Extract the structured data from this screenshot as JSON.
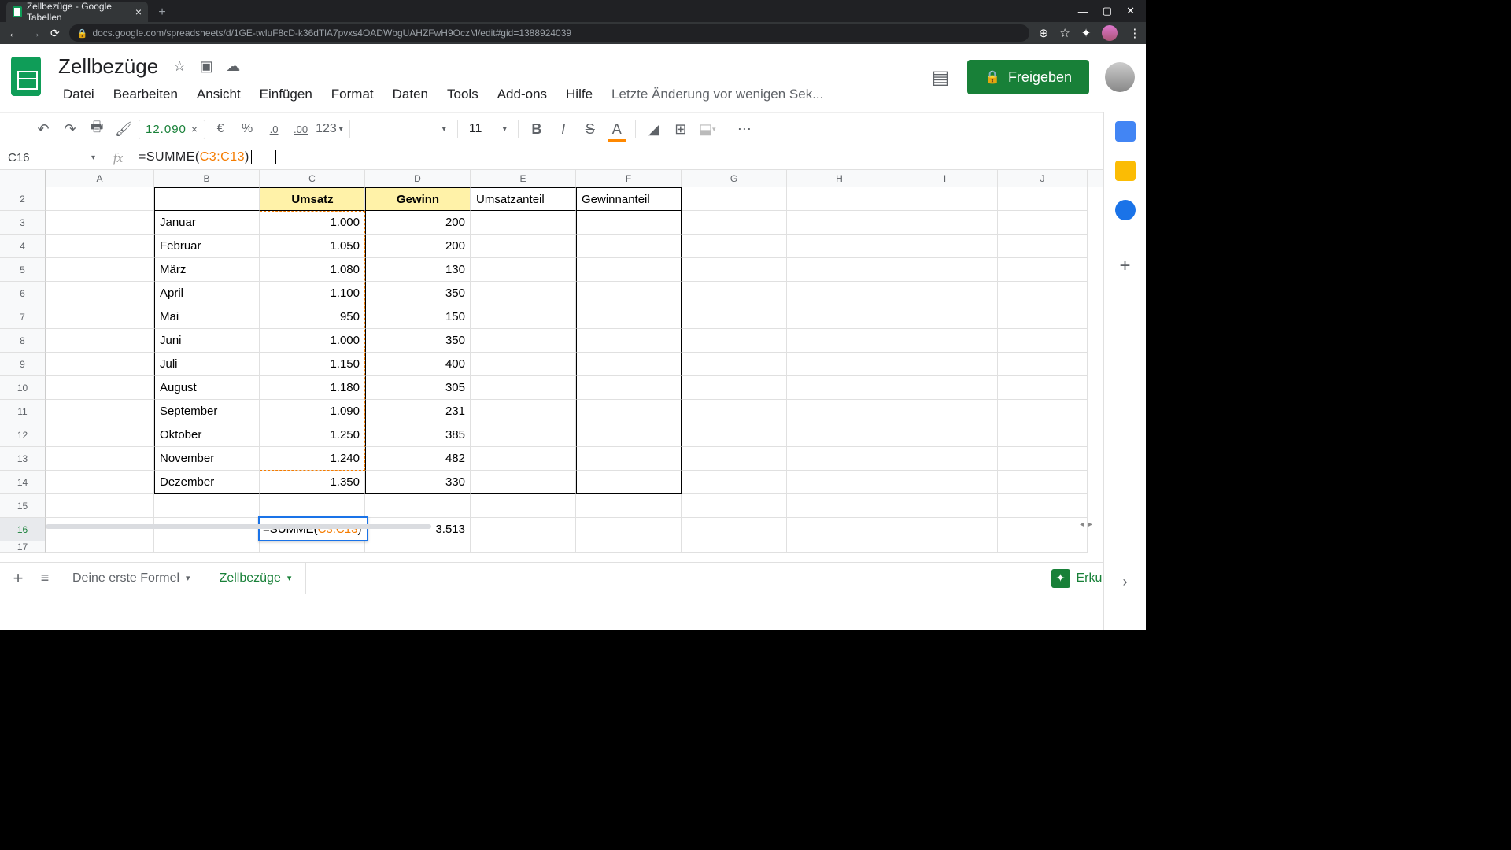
{
  "browser": {
    "tab_title": "Zellbezüge - Google Tabellen",
    "url": "docs.google.com/spreadsheets/d/1GE-twluF8cD-k36dTlA7pvxs4OADWbgUAHZFwH9OczM/edit#gid=1388924039"
  },
  "doc": {
    "title": "Zellbezüge",
    "last_edit": "Letzte Änderung vor wenigen Sek...",
    "share": "Freigeben"
  },
  "menu": {
    "file": "Datei",
    "edit": "Bearbeiten",
    "view": "Ansicht",
    "insert": "Einfügen",
    "format": "Format",
    "data": "Daten",
    "tools": "Tools",
    "addons": "Add-ons",
    "help": "Hilfe"
  },
  "toolbar": {
    "preview_value": "12.090",
    "currency": "€",
    "percent": "%",
    "dec_less": ".0",
    "dec_more": ".00",
    "numfmt": "123",
    "font_size": "11"
  },
  "formula": {
    "name_box": "C16",
    "prefix": "=SUMME(",
    "ref": "C3:C13",
    "suffix": ")"
  },
  "columns": [
    "A",
    "B",
    "C",
    "D",
    "E",
    "F",
    "G",
    "H",
    "I",
    "J"
  ],
  "headers": {
    "umsatz": "Umsatz",
    "gewinn": "Gewinn",
    "umsatzanteil": "Umsatzanteil",
    "gewinnanteil": "Gewinnanteil"
  },
  "rows": [
    {
      "n": "2"
    },
    {
      "n": "3",
      "month": "Januar",
      "umsatz": "1.000",
      "gewinn": "200"
    },
    {
      "n": "4",
      "month": "Februar",
      "umsatz": "1.050",
      "gewinn": "200"
    },
    {
      "n": "5",
      "month": "März",
      "umsatz": "1.080",
      "gewinn": "130"
    },
    {
      "n": "6",
      "month": "April",
      "umsatz": "1.100",
      "gewinn": "350"
    },
    {
      "n": "7",
      "month": "Mai",
      "umsatz": "950",
      "gewinn": "150"
    },
    {
      "n": "8",
      "month": "Juni",
      "umsatz": "1.000",
      "gewinn": "350"
    },
    {
      "n": "9",
      "month": "Juli",
      "umsatz": "1.150",
      "gewinn": "400"
    },
    {
      "n": "10",
      "month": "August",
      "umsatz": "1.180",
      "gewinn": "305"
    },
    {
      "n": "11",
      "month": "September",
      "umsatz": "1.090",
      "gewinn": "231"
    },
    {
      "n": "12",
      "month": "Oktober",
      "umsatz": "1.250",
      "gewinn": "385"
    },
    {
      "n": "13",
      "month": "November",
      "umsatz": "1.240",
      "gewinn": "482"
    },
    {
      "n": "14",
      "month": "Dezember",
      "umsatz": "1.350",
      "gewinn": "330"
    },
    {
      "n": "15"
    },
    {
      "n": "16",
      "d_sum": "3.513"
    },
    {
      "n": "17"
    }
  ],
  "edit_cell": {
    "prefix": "=SUMME(",
    "ref": "C3:C13",
    "suffix": ")"
  },
  "sheets": {
    "tab1": "Deine erste Formel",
    "tab2": "Zellbezüge",
    "explore": "Erkunden"
  }
}
